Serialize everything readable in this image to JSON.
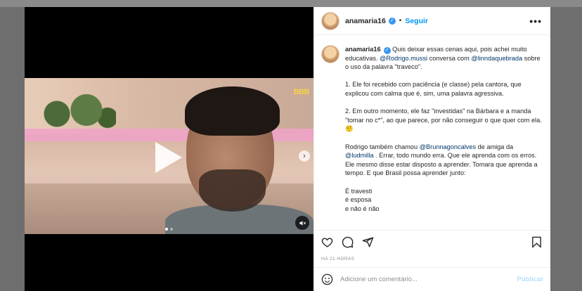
{
  "post": {
    "username": "anamaria16",
    "separator": "•",
    "follow_label": "Seguir",
    "more_icon": "•••",
    "video": {
      "logo_text": "BBB",
      "next_icon": "›",
      "carousel_position": 1,
      "carousel_count": 2
    },
    "caption": {
      "username": "anamaria16",
      "line1_pre": " Quis deixar essas cenas aqui, pois achei muito educativas. ",
      "mention1": "@Rodrigo.mussi",
      "line1_mid": " conversa com ",
      "mention2": "@linndaquebrada",
      "line1_post": " sobre o uso da palavra \"traveco\".",
      "para2": "1. Ele foi recebido com paciência (e classe) pela cantora, que explicou com calma que é, sim, uma palavra agressiva.",
      "para3": "2. Em outro momento, ele faz \"investidas\" na Bárbara e a manda \"tomar no c*\", ao que parece, por não conseguir o que quer com ela. 🤨",
      "para4_pre": "Rodrigo também chamou ",
      "mention3": "@Brunnagoncalves",
      "para4_mid": " de amiga da ",
      "mention4": "@ludmilla",
      "para4_post": " . Errar, todo mundo erra. Que ele aprenda com os erros. Ele mesmo disse estar disposto a aprender. Tomara que aprenda a tempo. E que Brasil possa aprender junto:",
      "line_a": "É travesti",
      "line_b": "é esposa",
      "line_c": "e não é não"
    },
    "timestamp": "HÁ 21 HORAS",
    "comment_placeholder": "Adicione um comentário...",
    "post_label": "Publicar",
    "colors": {
      "accent": "#0095f6",
      "mention": "#00376b",
      "verified": "#3897f0"
    }
  }
}
